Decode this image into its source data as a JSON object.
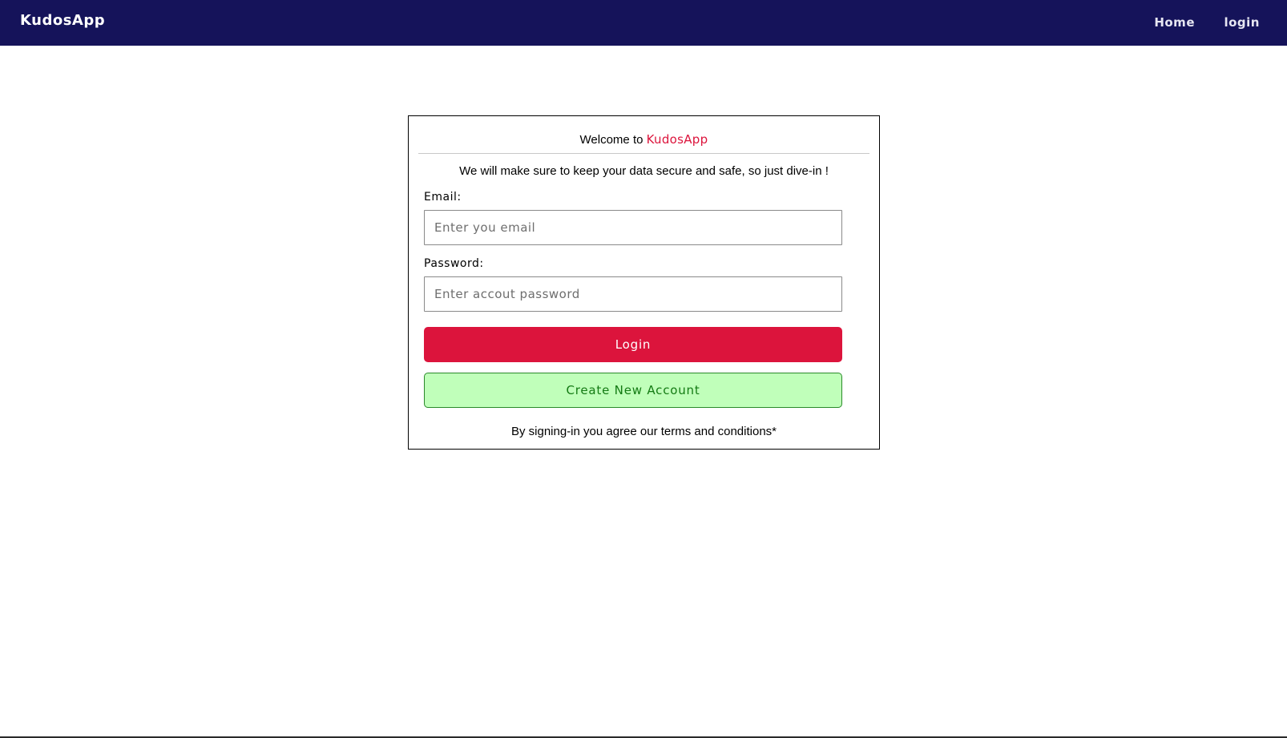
{
  "navbar": {
    "brand": "KudosApp",
    "links": [
      {
        "label": "Home"
      },
      {
        "label": "login"
      }
    ],
    "background_color": "#15135a"
  },
  "card": {
    "header_prefix": "Welcome to ",
    "header_brand": "KudosApp",
    "subtitle": "We will make sure to keep your data secure and safe, so just dive-in !",
    "email": {
      "label": "Email:",
      "placeholder": "Enter you email",
      "value": ""
    },
    "password": {
      "label": "Password:",
      "placeholder": "Enter accout password",
      "value": ""
    },
    "login_button": "Login",
    "create_button": "Create New Account",
    "terms": "By signing-in you agree our terms and conditions*"
  },
  "colors": {
    "accent": "#dc143c",
    "create_bg": "#c0ffba",
    "create_text": "#137a13"
  }
}
